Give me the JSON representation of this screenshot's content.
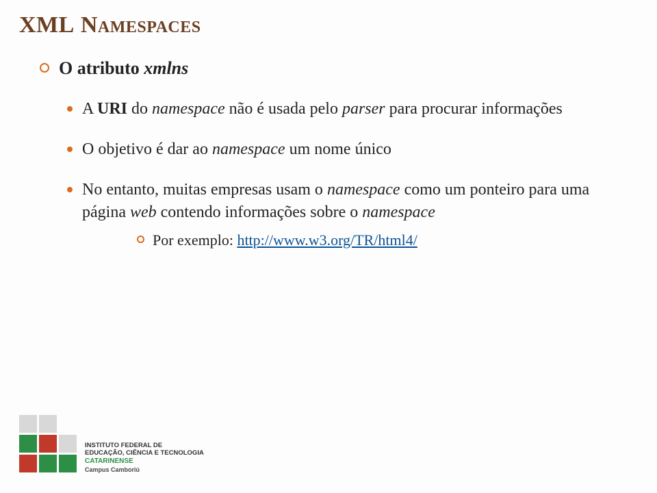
{
  "title_main": "XML",
  "title_sc": " Namespaces",
  "l1_pre": "O atributo ",
  "l1_em": "xmlns",
  "b1_pre": "A ",
  "b1_bold": "URI",
  "b1_mid": " do ",
  "b1_em1": "namespace",
  "b1_mid2": " não é usada pelo ",
  "b1_em2": "parser",
  "b1_post": " para procurar informações",
  "b2_pre": "O objetivo é dar ao ",
  "b2_em": "namespace",
  "b2_post": " um nome único",
  "b3_pre": "No entanto, muitas empresas usam o ",
  "b3_em1": "namespace",
  "b3_mid": " como um ponteiro para uma página ",
  "b3_em2": "web",
  "b3_mid2": " contendo informações sobre o ",
  "b3_em3": "namespace",
  "sub_label": "Por exemplo: ",
  "sub_link": "http://www.w3.org/TR/html4/",
  "logo_line1": "Instituto Federal de",
  "logo_line2": "Educação, Ciência e Tecnologia",
  "logo_line3": "Catarinense",
  "logo_line4": "Campus Camboriú"
}
